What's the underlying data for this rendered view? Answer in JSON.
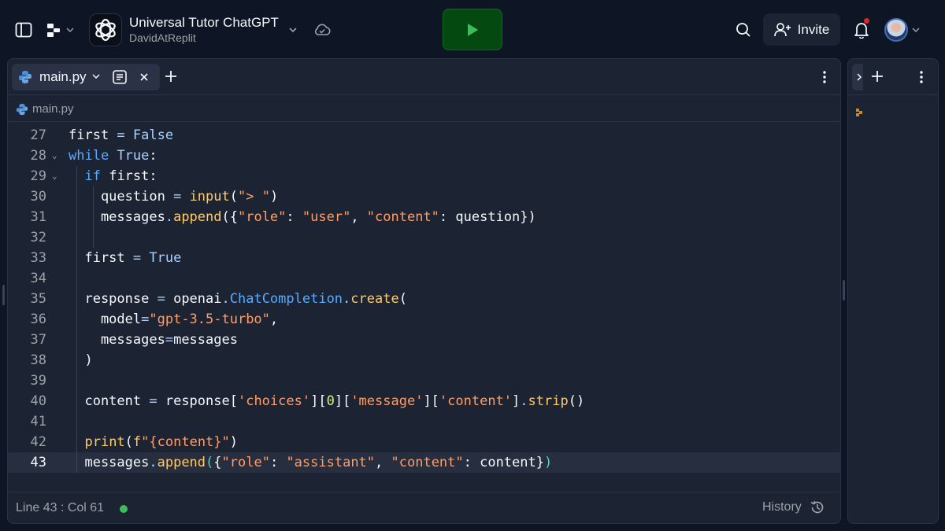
{
  "header": {
    "repl_title": "Universal Tutor ChatGPT",
    "repl_owner": "DavidAtReplit",
    "invite_label": "Invite",
    "colors": {
      "run": "#044a10",
      "run_icon": "#3fbc5a",
      "notification": "#e52222"
    }
  },
  "editor": {
    "tab_label": "main.py",
    "breadcrumb": "main.py",
    "code_lines": [
      {
        "n": "27",
        "text": "first = False"
      },
      {
        "n": "28",
        "text": "while True:"
      },
      {
        "n": "29",
        "text": "  if first:"
      },
      {
        "n": "30",
        "text": "    question = input(\"> \")"
      },
      {
        "n": "31",
        "text": "    messages.append({\"role\": \"user\", \"content\": question})"
      },
      {
        "n": "32",
        "text": ""
      },
      {
        "n": "33",
        "text": "  first = True"
      },
      {
        "n": "34",
        "text": ""
      },
      {
        "n": "35",
        "text": "  response = openai.ChatCompletion.create("
      },
      {
        "n": "36",
        "text": "    model=\"gpt-3.5-turbo\","
      },
      {
        "n": "37",
        "text": "    messages=messages"
      },
      {
        "n": "38",
        "text": "  )"
      },
      {
        "n": "39",
        "text": ""
      },
      {
        "n": "40",
        "text": "  content = response['choices'][0]['message']['content'].strip()"
      },
      {
        "n": "41",
        "text": ""
      },
      {
        "n": "42",
        "text": "  print(f\"{content}\")"
      },
      {
        "n": "43",
        "text": "  messages.append({\"role\": \"assistant\", \"content\": content})"
      }
    ],
    "active_line": "43"
  },
  "status": {
    "cursor_position": "Line 43 : Col 61",
    "history_label": "History"
  },
  "icons": {
    "sidebar": "sidebar-toggle-icon",
    "spaces": "spaces-icon",
    "logo": "openai-logo-icon",
    "cloud": "cloud-check-icon",
    "run": "play-icon",
    "search": "search-icon",
    "invite": "user-plus-icon",
    "bell": "bell-icon",
    "history": "history-icon"
  }
}
